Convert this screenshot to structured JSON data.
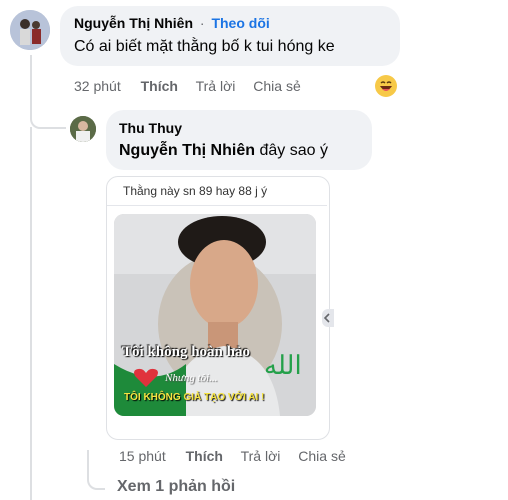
{
  "comment1": {
    "author": "Nguyễn Thị Nhiên",
    "separator": "·",
    "follow": "Theo dõi",
    "text": "Có ai biết mặt thằng bố k tui hóng ke",
    "time": "32 phút",
    "like": "Thích",
    "reply": "Trả lời",
    "share": "Chia sẻ",
    "reaction_icon": "laughing-emoji-icon"
  },
  "reply1": {
    "author": "Thu Thuy",
    "mention": "Nguyễn Thị Nhiên",
    "text": "đây sao ý",
    "shared_post": {
      "caption": "Thằng này sn 89 hay 88 j ý",
      "overlay_line1": "Tôi không hoàn hảo",
      "overlay_line2": "Nhưng tôi...",
      "overlay_line3": "TÔI KHÔNG GIẢ TẠO VỚI AI !"
    },
    "time": "15 phút",
    "like": "Thích",
    "reply": "Trả lời",
    "share": "Chia sẻ"
  },
  "more_replies": "Xem 1 phản hồi",
  "colors": {
    "link": "#1b74e4",
    "meta": "#65676b",
    "bubble": "#f0f2f5"
  }
}
